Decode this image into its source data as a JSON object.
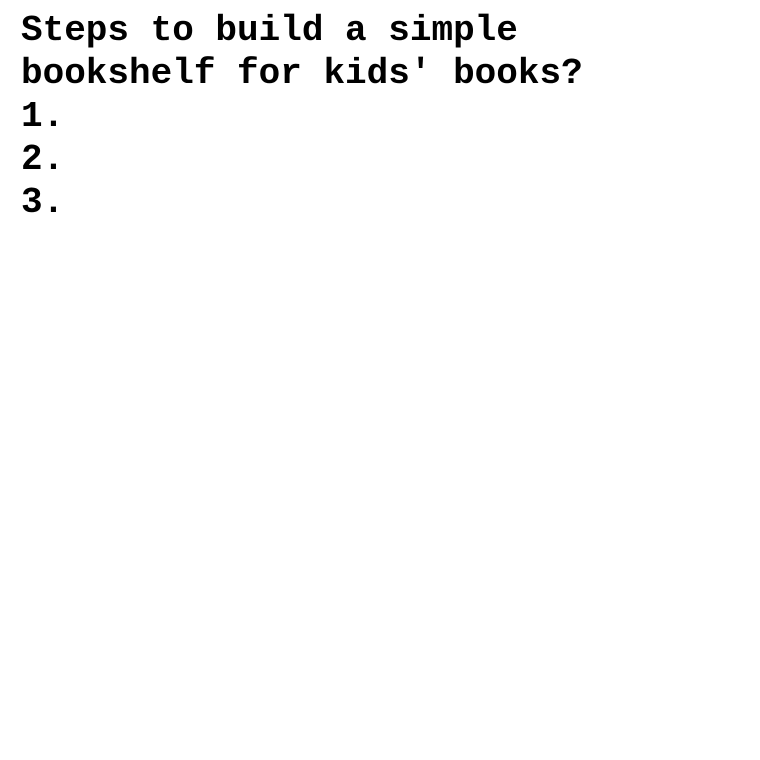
{
  "document": {
    "question_line_1": "Steps to build a simple",
    "question_line_2": "bookshelf for kids' books?",
    "steps": [
      "1.",
      "2.",
      "3."
    ]
  },
  "colors": {
    "background": "#ffffff",
    "text": "#000000"
  }
}
